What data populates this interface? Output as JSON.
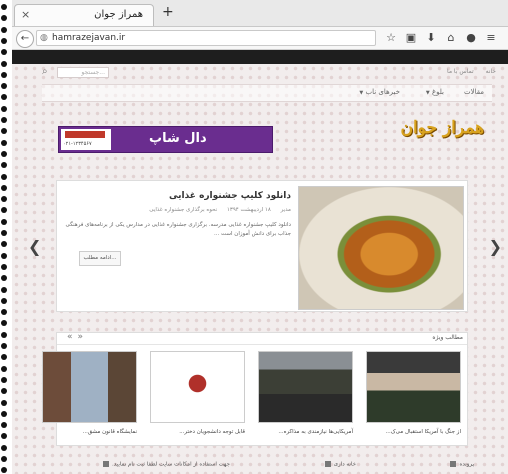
{
  "browser": {
    "tab_title": "همراز جوان",
    "close_glyph": "×",
    "new_tab_glyph": "+",
    "back_glyph": "←",
    "url": "hamrazejavan.ir",
    "tool_icons": [
      "☆",
      "▣",
      "⬇",
      "⌂",
      "●",
      "≡"
    ]
  },
  "site": {
    "search_placeholder": "جستجو...",
    "breadcrumbs": [
      "خانه",
      "تماس با ما"
    ],
    "menu": [
      "مقالات",
      "بلوغ",
      "خبرهای ناب"
    ],
    "logo": "همراز جوان",
    "ad": {
      "brand": "دال شاپ",
      "phone_line": "۰۲۱-۱۲۳۴۵۶۷"
    }
  },
  "feature": {
    "title": "دانلود کلیپ جشنواره غذایی",
    "meta": [
      "مدیر",
      "۱۸ اردیبهشت ۱۳۹۴",
      "نحوه برگذاری جشنواره غذایی"
    ],
    "excerpt": "دانلود کلیپ جشنواره غذایی مدرسه. برگزاری جشنواره غذایی در مدارس یکی از برنامه‌های فرهنگی جذاب برای دانش آموزان است ...",
    "more_label": "ادامه مطلب..."
  },
  "section": {
    "title": "مطالب ویژه",
    "nav_glyphs": "«»",
    "items": [
      {
        "caption": "از جنگ با آمریکا استقبال می‌ک...",
        "icon": "commander-photo-icon"
      },
      {
        "caption": "آمریکایی‌ها نیازمندی به مذاکره...",
        "icon": "crowd-photo-icon"
      },
      {
        "caption": "قابل توجه دانشجویان دختر...",
        "icon": "calligraphy-poster-icon"
      },
      {
        "caption": "نمایشگاه قانون مشق...",
        "icon": "exhibition-photo-icon"
      }
    ]
  },
  "footer": {
    "items": [
      "پرونده",
      "خانه داری",
      "جهت استفاده از امکانات سایت لطفا ثبت نام نمایید."
    ]
  }
}
